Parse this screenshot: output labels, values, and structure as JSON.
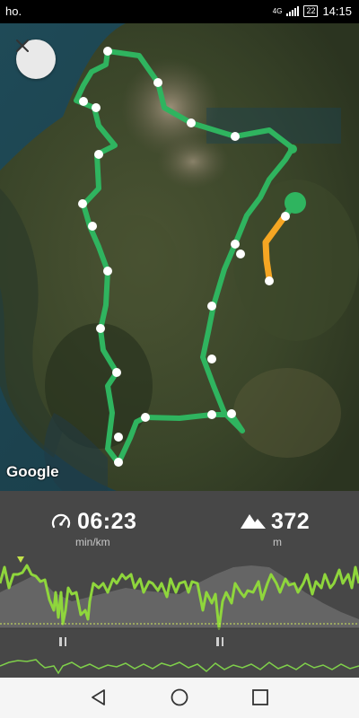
{
  "status_bar": {
    "carrier": "ho.",
    "network": "4G",
    "battery": "22",
    "time": "14:15"
  },
  "map": {
    "close_icon": "close-icon",
    "attribution": "Google",
    "route_color": "#2fb45f",
    "progress_color": "#f5a623"
  },
  "stats": {
    "pace": {
      "icon": "speedometer-icon",
      "value": "06:23",
      "unit": "min/km"
    },
    "elevation": {
      "icon": "mountain-icon",
      "value": "372",
      "unit": "m"
    }
  },
  "graph": {
    "line_color": "#7ed957",
    "elevation_color": "#6d6d6d",
    "pause_icon": "pause-icon"
  },
  "nav": {
    "back": "back-icon",
    "home": "home-icon",
    "recents": "recents-icon"
  }
}
